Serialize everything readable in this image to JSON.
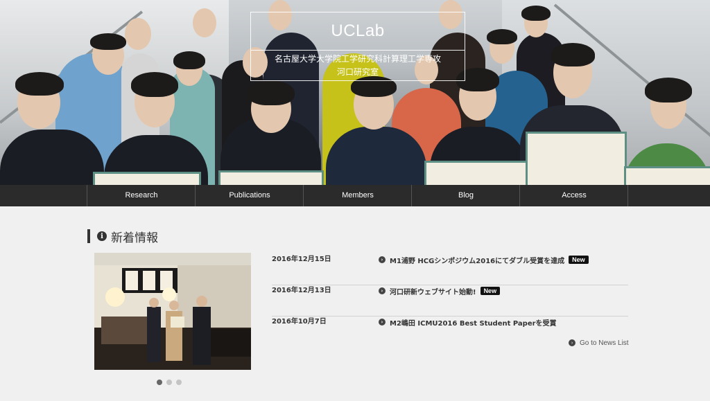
{
  "site": {
    "logo": "UCLab",
    "subtitle_line1": "名古屋大学大学院工学研究科計算理工学専攻",
    "subtitle_line2": "河口研究室"
  },
  "nav": {
    "items": [
      {
        "label": "Research"
      },
      {
        "label": "Publications"
      },
      {
        "label": "Members"
      },
      {
        "label": "Blog"
      },
      {
        "label": "Access"
      }
    ]
  },
  "news": {
    "section_title": "新着情報",
    "items": [
      {
        "date": "2016年12月15日",
        "title": "M1浦野 HCGシンポジウム2016にてダブル受賞を達成",
        "badge": "New"
      },
      {
        "date": "2016年12月13日",
        "title": "河口研新ウェブサイト始動!",
        "badge": "New"
      },
      {
        "date": "2016年10月7日",
        "title": "M2嶋田 ICMU2016 Best Student Paperを受賞",
        "badge": ""
      }
    ],
    "more_link": "Go to News List"
  },
  "carousel": {
    "slide_count": 3,
    "active_index": 0
  },
  "icons": {
    "section": "info-circle-icon",
    "news_bullet": "chevron-circle-right-icon"
  },
  "colors": {
    "nav_bg": "#2b2b2b",
    "page_bg": "#f0f0f0",
    "badge_bg": "#111111"
  }
}
